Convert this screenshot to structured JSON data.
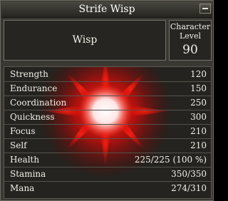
{
  "window": {
    "title": "Strife Wisp"
  },
  "info": {
    "name": "Wisp",
    "level_label_line1": "Character",
    "level_label_line2": "Level",
    "level_value": "90"
  },
  "stats": [
    {
      "label": "Strength",
      "value": "120"
    },
    {
      "label": "Endurance",
      "value": "150"
    },
    {
      "label": "Coordination",
      "value": "250"
    },
    {
      "label": "Quickness",
      "value": "300"
    },
    {
      "label": "Focus",
      "value": "210"
    },
    {
      "label": "Self",
      "value": "210"
    },
    {
      "label": "Health",
      "value": "225/225 (100 %)"
    },
    {
      "label": "Stamina",
      "value": "350/350"
    },
    {
      "label": "Mana",
      "value": "274/310"
    }
  ],
  "icons": {
    "close": "minimize-icon",
    "portrait": "wisp-glow-image"
  },
  "colors": {
    "glow_core": "#ffffff",
    "glow_outer": "#ff1a10",
    "panel": "#24231f",
    "frame": "#3a3833"
  }
}
